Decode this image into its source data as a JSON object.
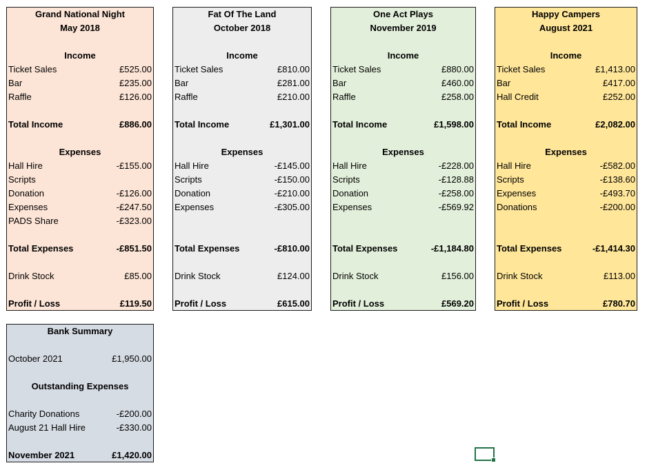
{
  "colors": {
    "panel1": "#fce4d6",
    "panel2": "#ededed",
    "panel3": "#e2efda",
    "panel4": "#ffe699",
    "panel5": "#d6dce4",
    "cursor": "#217346"
  },
  "events": [
    {
      "title": "Grand National Night",
      "date": "May 2018",
      "income_heading": "Income",
      "income": [
        {
          "label": "Ticket Sales",
          "value": "£525.00"
        },
        {
          "label": "Bar",
          "value": "£235.00"
        },
        {
          "label": "Raffle",
          "value": "£126.00"
        }
      ],
      "total_income": {
        "label": "Total Income",
        "value": "£886.00"
      },
      "expenses_heading": "Expenses",
      "expenses": [
        {
          "label": "Hall Hire",
          "value": "-£155.00"
        },
        {
          "label": "Scripts",
          "value": ""
        },
        {
          "label": "Donation",
          "value": "-£126.00"
        },
        {
          "label": "Expenses",
          "value": "-£247.50"
        },
        {
          "label": "PADS Share",
          "value": "-£323.00"
        }
      ],
      "total_expenses": {
        "label": "Total Expenses",
        "value": "-£851.50"
      },
      "drink_stock": {
        "label": "Drink Stock",
        "value": "£85.00"
      },
      "profit": {
        "label": "Profit / Loss",
        "value": "£119.50"
      }
    },
    {
      "title": "Fat Of The Land",
      "date": "October 2018",
      "income_heading": "Income",
      "income": [
        {
          "label": "Ticket Sales",
          "value": "£810.00"
        },
        {
          "label": "Bar",
          "value": "£281.00"
        },
        {
          "label": "Raffle",
          "value": "£210.00"
        }
      ],
      "total_income": {
        "label": "Total Income",
        "value": "£1,301.00"
      },
      "expenses_heading": "Expenses",
      "expenses": [
        {
          "label": "Hall Hire",
          "value": "-£145.00"
        },
        {
          "label": "Scripts",
          "value": "-£150.00"
        },
        {
          "label": "Donation",
          "value": "-£210.00"
        },
        {
          "label": "Expenses",
          "value": "-£305.00"
        }
      ],
      "total_expenses": {
        "label": "Total Expenses",
        "value": "-£810.00"
      },
      "drink_stock": {
        "label": "Drink Stock",
        "value": "£124.00"
      },
      "profit": {
        "label": "Profit / Loss",
        "value": "£615.00"
      }
    },
    {
      "title": "One Act Plays",
      "date": "November 2019",
      "income_heading": "Income",
      "income": [
        {
          "label": "Ticket Sales",
          "value": "£880.00"
        },
        {
          "label": "Bar",
          "value": "£460.00"
        },
        {
          "label": "Raffle",
          "value": "£258.00"
        }
      ],
      "total_income": {
        "label": "Total Income",
        "value": "£1,598.00"
      },
      "expenses_heading": "Expenses",
      "expenses": [
        {
          "label": "Hall Hire",
          "value": "-£228.00"
        },
        {
          "label": "Scripts",
          "value": "-£128.88"
        },
        {
          "label": "Donation",
          "value": "-£258.00"
        },
        {
          "label": "Expenses",
          "value": "-£569.92"
        }
      ],
      "total_expenses": {
        "label": "Total Expenses",
        "value": "-£1,184.80"
      },
      "drink_stock": {
        "label": "Drink Stock",
        "value": "£156.00"
      },
      "profit": {
        "label": "Profit / Loss",
        "value": "£569.20"
      }
    },
    {
      "title": "Happy Campers",
      "date": "August 2021",
      "income_heading": "Income",
      "income": [
        {
          "label": "Ticket Sales",
          "value": "£1,413.00"
        },
        {
          "label": "Bar",
          "value": "£417.00"
        },
        {
          "label": "Hall Credit",
          "value": "£252.00"
        }
      ],
      "total_income": {
        "label": "Total Income",
        "value": "£2,082.00"
      },
      "expenses_heading": "Expenses",
      "expenses": [
        {
          "label": "Hall Hire",
          "value": "-£582.00"
        },
        {
          "label": "Scripts",
          "value": "-£138.60"
        },
        {
          "label": "Expenses",
          "value": "-£493.70"
        },
        {
          "label": "Donations",
          "value": "-£200.00"
        }
      ],
      "total_expenses": {
        "label": "Total Expenses",
        "value": "-£1,414.30"
      },
      "drink_stock": {
        "label": "Drink Stock",
        "value": "£113.00"
      },
      "profit": {
        "label": "Profit / Loss",
        "value": "£780.70"
      }
    }
  ],
  "bank": {
    "title": "Bank Summary",
    "balance": {
      "label": "October 2021",
      "value": "£1,950.00"
    },
    "outstanding_heading": "Outstanding Expenses",
    "outstanding": [
      {
        "label": "Charity Donations",
        "value": "-£200.00"
      },
      {
        "label": "August 21 Hall Hire",
        "value": "-£330.00"
      }
    ],
    "final": {
      "label": "November 2021",
      "value": "£1,420.00"
    }
  }
}
